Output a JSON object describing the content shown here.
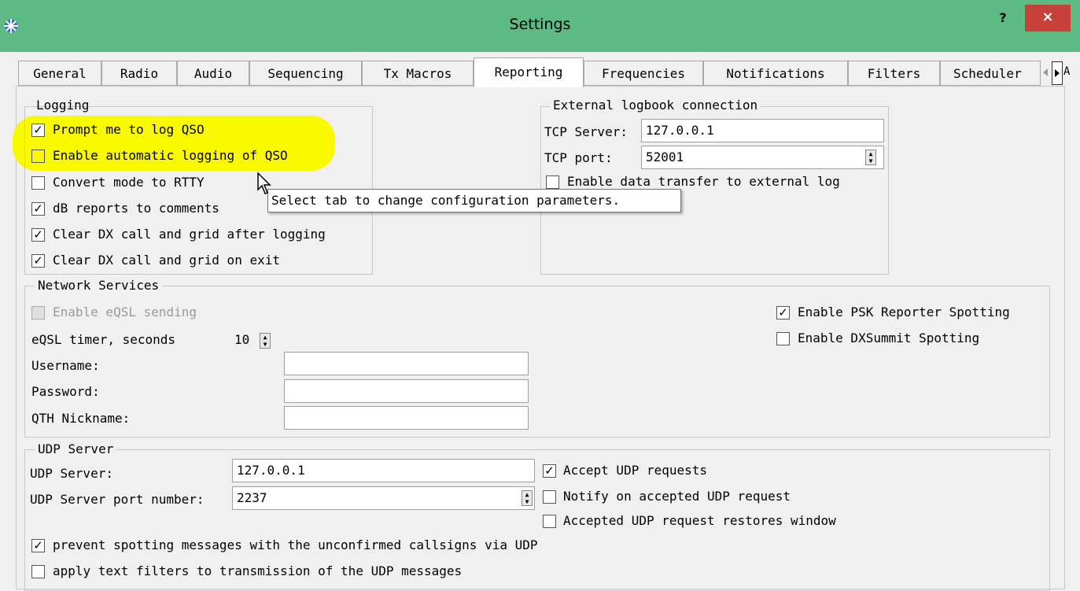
{
  "window": {
    "title": "Settings",
    "help": "?",
    "close": "×"
  },
  "tabs": [
    {
      "label": "General"
    },
    {
      "label": "Radio"
    },
    {
      "label": "Audio"
    },
    {
      "label": "Sequencing"
    },
    {
      "label": "Tx Macros"
    },
    {
      "label": "Reporting",
      "active": true
    },
    {
      "label": "Frequencies"
    },
    {
      "label": "Notifications"
    },
    {
      "label": "Filters"
    },
    {
      "label": "Scheduler"
    },
    {
      "label": "A"
    }
  ],
  "logging": {
    "title": "Logging",
    "items": [
      {
        "label": "Prompt me to log QSO",
        "checked": true
      },
      {
        "label": "Enable automatic logging of QSO",
        "checked": false
      },
      {
        "label": "Convert mode to RTTY",
        "checked": false
      },
      {
        "label": "dB reports to comments",
        "checked": true
      },
      {
        "label": "Clear DX call and grid after logging",
        "checked": true
      },
      {
        "label": "Clear DX call and grid on exit",
        "checked": true
      }
    ]
  },
  "external_log": {
    "title": "External logbook connection",
    "tcp_server_label": "TCP Server:",
    "tcp_server_value": "127.0.0.1",
    "tcp_port_label": "TCP port:",
    "tcp_port_value": "52001",
    "enable_transfer_label": "Enable data transfer to external log",
    "enable_transfer_checked": false
  },
  "tooltip": {
    "text": "Select tab to change configuration parameters."
  },
  "network": {
    "title": "Network Services",
    "eqsl_label": "Enable eQSL sending",
    "eqsl_timer_label": "eQSL timer, seconds",
    "eqsl_timer_value": "10",
    "username_label": "Username:",
    "username_value": "",
    "password_label": "Password:",
    "password_value": "",
    "qth_label": "QTH Nickname:",
    "qth_value": "",
    "psk_label": "Enable PSK Reporter Spotting",
    "psk_checked": true,
    "dxsummit_label": "Enable DXSummit Spotting",
    "dxsummit_checked": false
  },
  "udp": {
    "title": "UDP Server",
    "server_label": "UDP Server:",
    "server_value": "127.0.0.1",
    "port_label": "UDP Server port number:",
    "port_value": "2237",
    "accept_label": "Accept UDP requests",
    "accept_checked": true,
    "notify_label": "Notify on accepted UDP request",
    "notify_checked": false,
    "restore_label": "Accepted UDP request restores window",
    "restore_checked": false,
    "prevent_label": "prevent spotting messages with the unconfirmed callsigns via UDP",
    "prevent_checked": true,
    "apply_label": "apply text filters to transmission of the UDP messages",
    "apply_checked": false
  },
  "colors": {
    "titlebar": "#5dba82",
    "close": "#c7413a",
    "highlight": "#f9f900"
  }
}
